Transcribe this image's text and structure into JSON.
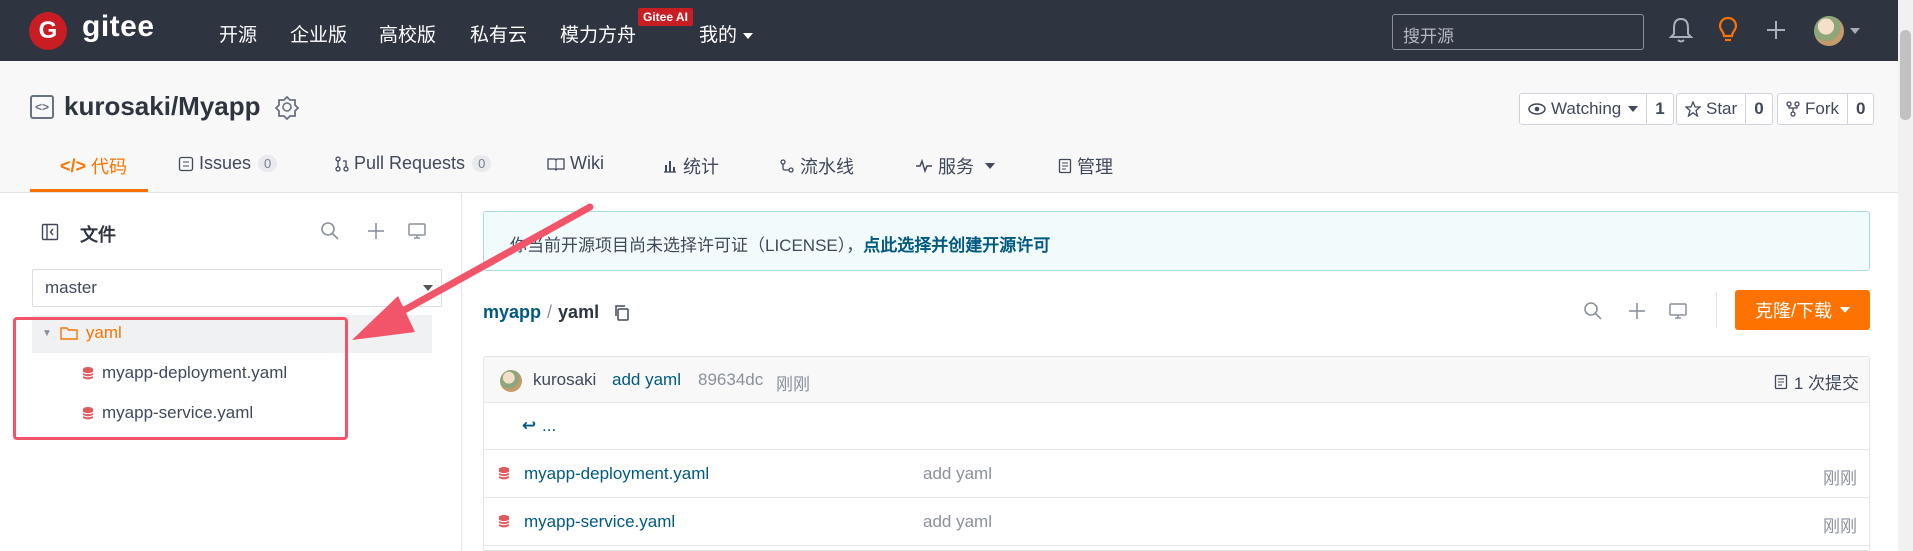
{
  "topbar": {
    "logo_letter": "G",
    "logo_text": "gitee",
    "nav": [
      "开源",
      "企业版",
      "高校版",
      "私有云",
      "模力方舟",
      "我的"
    ],
    "ai_badge": "Gitee AI",
    "search_placeholder": "搜开源"
  },
  "repo": {
    "title": "kurosaki/Myapp",
    "watching_label": "Watching",
    "watching_count": "1",
    "star_label": "Star",
    "star_count": "0",
    "fork_label": "Fork",
    "fork_count": "0",
    "tabs": [
      {
        "label": "代码"
      },
      {
        "label": "Issues",
        "count": "0"
      },
      {
        "label": "Pull Requests",
        "count": "0"
      },
      {
        "label": "Wiki"
      },
      {
        "label": "统计"
      },
      {
        "label": "流水线"
      },
      {
        "label": "服务"
      },
      {
        "label": "管理"
      }
    ]
  },
  "sidebar": {
    "title": "文件",
    "branch": "master",
    "tree": {
      "folder": "yaml",
      "files": [
        "myapp-deployment.yaml",
        "myapp-service.yaml"
      ]
    }
  },
  "main": {
    "license_notice": "你当前开源项目尚未选择许可证（LICENSE），",
    "license_link": "点此选择并创建开源许可",
    "breadcrumb_repo": "myapp",
    "breadcrumb_sep": "/",
    "breadcrumb_dir": "yaml",
    "clone_label": "克隆/下载",
    "commit": {
      "author": "kurosaki",
      "message": "add yaml",
      "hash": "89634dc",
      "time": "刚刚",
      "count_label": "1 次提交"
    },
    "parent_label": "...",
    "files": [
      {
        "name": "myapp-deployment.yaml",
        "message": "add yaml",
        "time": "刚刚"
      },
      {
        "name": "myapp-service.yaml",
        "message": "add yaml",
        "time": "刚刚"
      }
    ]
  },
  "colors": {
    "accent": "#fe7300",
    "brand_red": "#c71d23",
    "annotation": "#f2546a",
    "link": "#005980"
  }
}
